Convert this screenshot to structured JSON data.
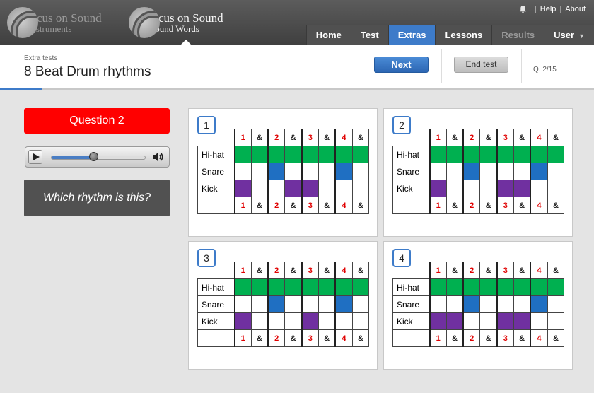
{
  "brands": [
    {
      "line1": "Focus on Sound",
      "line2": "Instruments",
      "active": false
    },
    {
      "line1": "Focus on Sound",
      "line2": "Sound Words",
      "active": true
    }
  ],
  "util": {
    "help": "Help",
    "about": "About"
  },
  "nav": [
    {
      "label": "Home",
      "state": "normal"
    },
    {
      "label": "Test",
      "state": "normal"
    },
    {
      "label": "Extras",
      "state": "active"
    },
    {
      "label": "Lessons",
      "state": "normal"
    },
    {
      "label": "Results",
      "state": "disabled"
    },
    {
      "label": "User",
      "state": "normal",
      "caret": "▼"
    }
  ],
  "page": {
    "breadcrumb": "Extra tests",
    "title": "8 Beat Drum rhythms",
    "next_label": "Next",
    "end_label": "End test",
    "question_counter": "Q. 2/15",
    "progress": 0.07
  },
  "question": {
    "label": "Question 2",
    "prompt": "Which rhythm is this?",
    "audio_progress": 0.45
  },
  "colors": {
    "accent": "#3d7bc9",
    "hihat": "#00b050",
    "snare": "#1f6fc2",
    "kick": "#7030a0",
    "beat_number": "#e00000",
    "question_bg": "#ff0000"
  },
  "grid_header": [
    "1",
    "&",
    "2",
    "&",
    "3",
    "&",
    "4",
    "&"
  ],
  "rows": [
    "Hi-hat",
    "Snare",
    "Kick"
  ],
  "options": [
    {
      "number": "1",
      "hihat": [
        1,
        1,
        1,
        1,
        1,
        1,
        1,
        1
      ],
      "snare": [
        0,
        0,
        1,
        0,
        0,
        0,
        1,
        0
      ],
      "kick": [
        1,
        0,
        0,
        1,
        1,
        0,
        0,
        0
      ]
    },
    {
      "number": "2",
      "hihat": [
        1,
        1,
        1,
        1,
        1,
        1,
        1,
        1
      ],
      "snare": [
        0,
        0,
        1,
        0,
        0,
        0,
        1,
        0
      ],
      "kick": [
        1,
        0,
        0,
        0,
        1,
        1,
        0,
        0
      ]
    },
    {
      "number": "3",
      "hihat": [
        1,
        1,
        1,
        1,
        1,
        1,
        1,
        1
      ],
      "snare": [
        0,
        0,
        1,
        0,
        0,
        0,
        1,
        0
      ],
      "kick": [
        1,
        0,
        0,
        0,
        1,
        0,
        0,
        0
      ]
    },
    {
      "number": "4",
      "hihat": [
        1,
        1,
        1,
        1,
        1,
        1,
        1,
        1
      ],
      "snare": [
        0,
        0,
        1,
        0,
        0,
        0,
        1,
        0
      ],
      "kick": [
        1,
        1,
        0,
        0,
        1,
        1,
        0,
        0
      ]
    }
  ]
}
